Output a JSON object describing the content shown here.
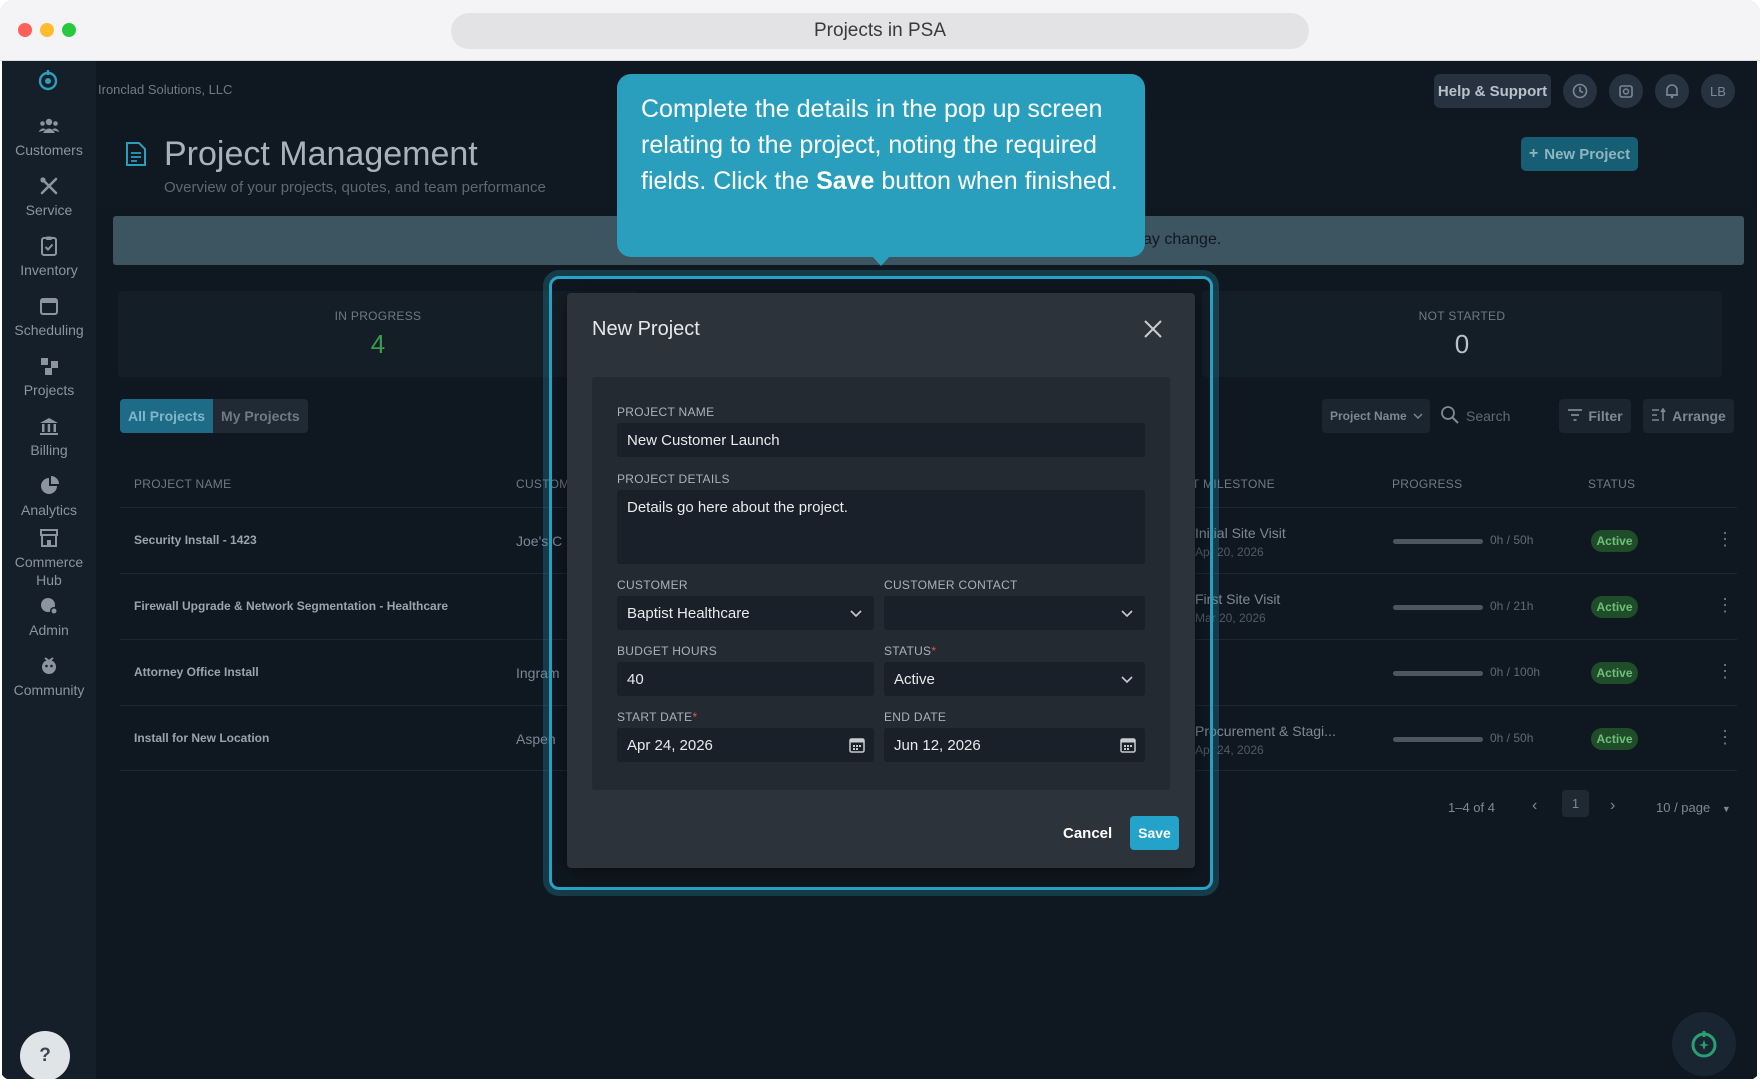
{
  "browser": {
    "url_title": "Projects in PSA"
  },
  "sidebar": {
    "items": [
      {
        "label": "Customers",
        "icon": "users-icon"
      },
      {
        "label": "Service",
        "icon": "tools-icon"
      },
      {
        "label": "Inventory",
        "icon": "clipboard-icon"
      },
      {
        "label": "Scheduling",
        "icon": "calendar-icon"
      },
      {
        "label": "Projects",
        "icon": "projects-icon"
      },
      {
        "label": "Billing",
        "icon": "bank-icon"
      },
      {
        "label": "Analytics",
        "icon": "pie-chart-icon"
      },
      {
        "label": "Commerce Hub",
        "icon": "store-icon"
      },
      {
        "label": "Admin",
        "icon": "admin-icon"
      },
      {
        "label": "Community",
        "icon": "community-icon"
      }
    ]
  },
  "topbar": {
    "company": "Ironclad Solutions, LLC",
    "help_label": "Help & Support",
    "avatar_initials": "LB"
  },
  "header": {
    "title": "Project Management",
    "subtitle": "Overview of your projects, quotes, and team performance",
    "new_project_label": "New Project"
  },
  "banner": {
    "text_visible": "ay change."
  },
  "stats": [
    {
      "label": "IN PROGRESS",
      "value": "4",
      "color": "#3f9a4f"
    },
    {
      "label": "NOT STARTED",
      "value": "0",
      "color": "#b9c1c9"
    }
  ],
  "tabs": {
    "all": "All Projects",
    "mine": "My Projects"
  },
  "toolbar": {
    "sort_label": "Project Name",
    "search_placeholder": "Search",
    "filter_label": "Filter",
    "arrange_label": "Arrange"
  },
  "table": {
    "headers": {
      "name": "PROJECT NAME",
      "customer": "CUSTOM",
      "milestone": "T MILESTONE",
      "progress": "PROGRESS",
      "status": "STATUS"
    },
    "rows": [
      {
        "name": "Security Install - 1423",
        "customer": "Joe's C",
        "milestone": "Initial Site Visit",
        "milestone_date": "Apr 20, 2026",
        "hours": "0h / 50h",
        "status": "Active"
      },
      {
        "name": "Firewall Upgrade & Network Segmentation - Healthcare",
        "customer": "",
        "milestone": "First Site Visit",
        "milestone_date": "Mar 20, 2026",
        "hours": "0h / 21h",
        "status": "Active"
      },
      {
        "name": "Attorney Office Install",
        "customer": "Ingram",
        "milestone": "",
        "milestone_date": "",
        "hours": "0h / 100h",
        "status": "Active"
      },
      {
        "name": "Install for New Location",
        "customer": "Aspen",
        "milestone": "Procurement & Stagi...",
        "milestone_date": "Apr 24, 2026",
        "hours": "0h / 50h",
        "status": "Active"
      }
    ]
  },
  "pagination": {
    "range": "1–4 of 4",
    "page": "1",
    "per_page": "10 / page"
  },
  "tooltip": {
    "text_before": "Complete the details in the pop up screen relating to the project, noting the required fields. Click the ",
    "bold": "Save",
    "text_after": " button when finished."
  },
  "modal": {
    "title": "New Project",
    "project_name_label": "PROJECT NAME",
    "project_name_value": "New Customer Launch",
    "project_details_label": "PROJECT DETAILS",
    "project_details_value": "Details go here about the project.",
    "customer_label": "CUSTOMER",
    "customer_value": "Baptist Healthcare",
    "contact_label": "CUSTOMER CONTACT",
    "contact_value": "",
    "budget_label": "BUDGET HOURS",
    "budget_value": "40",
    "status_label": "STATUS",
    "status_value": "Active",
    "start_label": "START DATE",
    "start_value": "Apr 24, 2026",
    "end_label": "END DATE",
    "end_value": "Jun 12, 2026",
    "required_mark": "*",
    "cancel_label": "Cancel",
    "save_label": "Save"
  },
  "help_fab": "?",
  "colors": {
    "accent": "#2a9fbd",
    "active_badge": "#1f4d2a",
    "save": "#23a3c9"
  }
}
